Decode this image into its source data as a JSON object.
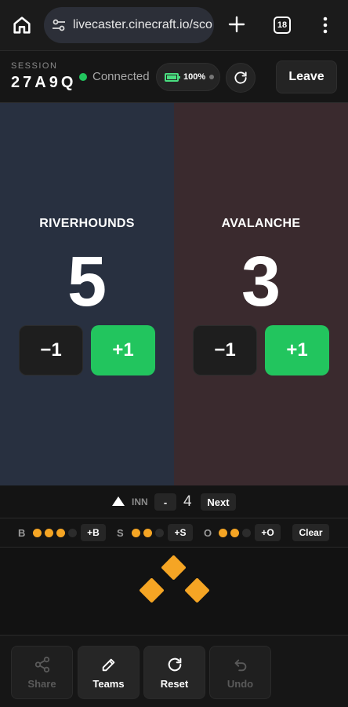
{
  "browser": {
    "url": "livecaster.cinecraft.io/sco",
    "tab_count": "18"
  },
  "session": {
    "label": "SESSION",
    "code": "27A9Q",
    "status": "Connected",
    "battery": "100%",
    "leave_label": "Leave"
  },
  "teams": [
    {
      "name": "RIVERHOUNDS",
      "score": "5",
      "minus_label": "−1",
      "plus_label": "+1"
    },
    {
      "name": "AVALANCHE",
      "score": "3",
      "minus_label": "−1",
      "plus_label": "+1"
    }
  ],
  "inning": {
    "label": "INN",
    "minus_label": "-",
    "value": "4",
    "next_label": "Next",
    "half": "top"
  },
  "count": {
    "balls": {
      "label": "B",
      "value": 3,
      "max": 4,
      "button": "+B"
    },
    "strikes": {
      "label": "S",
      "value": 2,
      "max": 3,
      "button": "+S"
    },
    "outs": {
      "label": "O",
      "value": 2,
      "max": 3,
      "button": "+O"
    },
    "clear_label": "Clear"
  },
  "bases": {
    "first": true,
    "second": true,
    "third": true
  },
  "colors": {
    "accent_green": "#22c55e",
    "count_orange": "#f5a524",
    "home_panel": "#283040",
    "away_panel": "#3a2a2e"
  },
  "toolbar": {
    "share": {
      "label": "Share",
      "icon": "share-icon",
      "enabled": false
    },
    "teams": {
      "label": "Teams",
      "icon": "pencil-icon",
      "enabled": true
    },
    "reset": {
      "label": "Reset",
      "icon": "reset-icon",
      "enabled": true
    },
    "undo": {
      "label": "Undo",
      "icon": "undo-icon",
      "enabled": false
    }
  }
}
